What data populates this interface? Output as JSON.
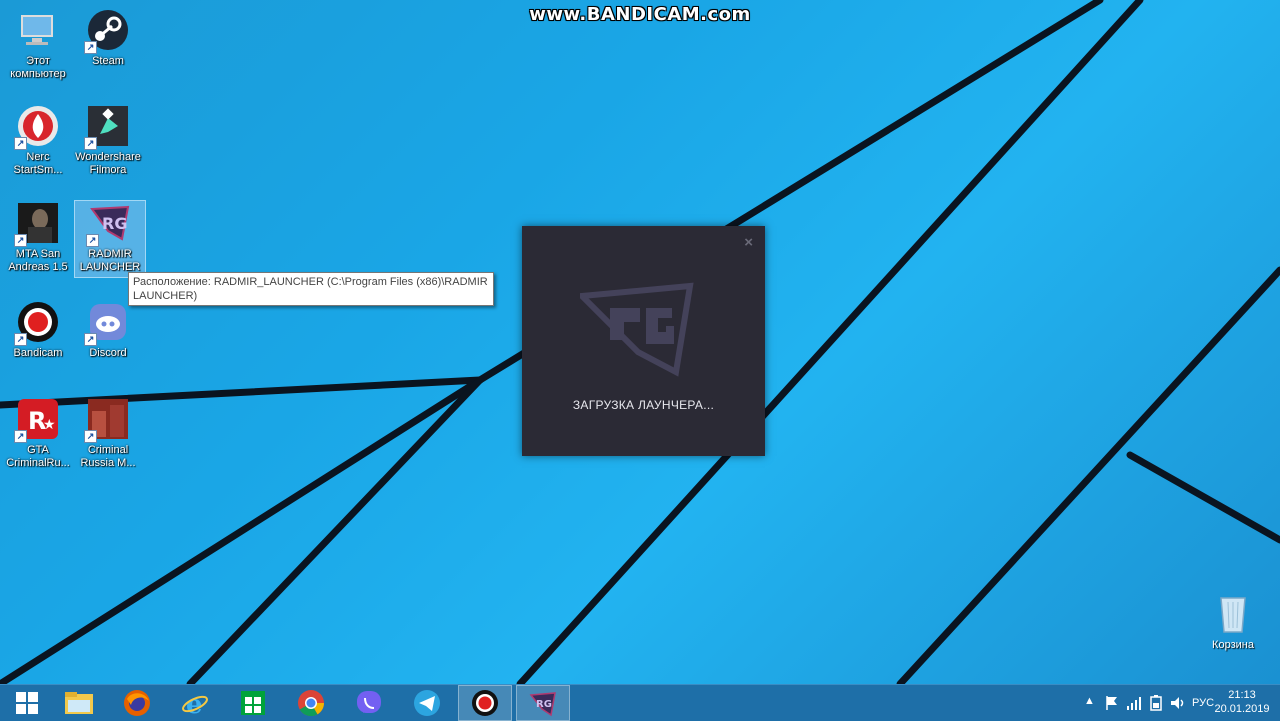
{
  "watermark": "www.BANDICAM.com",
  "desktop_icons": [
    {
      "label": "Этот компьютер"
    },
    {
      "label": "Steam"
    },
    {
      "label": "Nerc StartSm..."
    },
    {
      "label": "Wondershare Filmora"
    },
    {
      "label": "MTA San Andreas 1.5"
    },
    {
      "label": "RADMIR LAUNCHER"
    },
    {
      "label": "Bandicam"
    },
    {
      "label": "Discord"
    },
    {
      "label": "GTA CriminalRu..."
    },
    {
      "label": "Criminal Russia M..."
    }
  ],
  "tooltip": "Расположение: RADMIR_LAUNCHER (C:\\Program Files (x86)\\RADMIR LAUNCHER)",
  "launcher": {
    "close": "×",
    "status": "ЗАГРУЗКА ЛАУНЧЕРА..."
  },
  "recycle_bin": "Корзина",
  "taskbar": {
    "apps": [
      "start",
      "file-explorer",
      "firefox",
      "internet-explorer",
      "store",
      "chrome",
      "viber",
      "telegram",
      "bandicam",
      "radmir-launcher"
    ],
    "language": "РУС",
    "time": "21:13",
    "date": "20.01.2019"
  }
}
